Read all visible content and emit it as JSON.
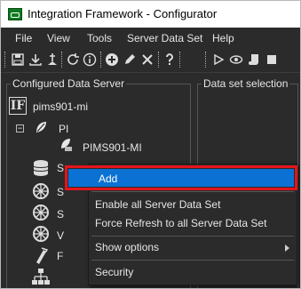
{
  "window": {
    "title": "Integration Framework - Configurator",
    "icon": "integration-framework-app-icon"
  },
  "menu": [
    "File",
    "View",
    "Tools",
    "Server Data Set",
    "Help"
  ],
  "toolbar": {
    "icons": [
      "save-icon",
      "download-icon",
      "deploy-icon",
      "refresh-icon",
      "info-icon",
      "add-icon",
      "edit-icon",
      "delete-icon",
      "help-icon",
      "play-icon",
      "preview-icon",
      "script-icon",
      "stop-icon"
    ]
  },
  "panels": {
    "left_title": "Configured Data Server",
    "right_title": "Data set selection"
  },
  "tree": {
    "server": "pims901-mi",
    "pi_node": "PI",
    "pi_child": "PIMS901-MI",
    "partial_labels": [
      "S",
      "S",
      "S",
      "V",
      "F"
    ]
  },
  "context_menu": {
    "items": [
      {
        "label": "Add",
        "highlighted": true
      },
      {
        "label": "Enable all Server Data Set"
      },
      {
        "label": "Force Refresh to all Server Data Set"
      },
      {
        "label": "Show options",
        "submenu": true
      },
      {
        "label": "Security"
      }
    ]
  },
  "colors": {
    "highlight": "#0b72d4",
    "annotation_border": "#e5141a",
    "background": "#2b2b2b"
  }
}
